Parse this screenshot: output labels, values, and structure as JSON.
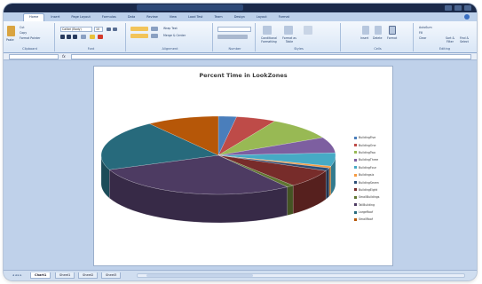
{
  "ribbon": {
    "tabs": [
      "Home",
      "Insert",
      "Page Layout",
      "Formulas",
      "Data",
      "Review",
      "View",
      "Load Test",
      "Team",
      "Design",
      "Layout",
      "Format"
    ],
    "groups": {
      "clipboard": "Clipboard",
      "font": "Font",
      "alignment": "Alignment",
      "number": "Number",
      "styles": "Styles",
      "cells": "Cells",
      "editing": "Editing"
    },
    "clipboard_buttons": {
      "paste": "Paste",
      "cut": "Cut",
      "copy": "Copy",
      "format_painter": "Format Painter"
    },
    "font_name": "Calibri (Body)",
    "font_size": "10",
    "alignment_buttons": {
      "wrap": "Wrap Text",
      "merge": "Merge & Center"
    },
    "styles_buttons": {
      "conditional": "Conditional Formatting",
      "table": "Format as Table"
    },
    "cells_buttons": {
      "insert": "Insert",
      "delete": "Delete",
      "format": "Format"
    },
    "editing_buttons": {
      "autosum": "AutoSum",
      "fill": "Fill",
      "clear": "Clear",
      "sort": "Sort & Filter",
      "find": "Find & Select"
    }
  },
  "formula_bar": {
    "fx": "fx"
  },
  "sheets": [
    "Chart1",
    "Sheet1",
    "Sheet2",
    "Sheet3"
  ],
  "active_sheet": "Chart1",
  "colors": {
    "accent": "#1b2a4a",
    "ribbon": "#d9e6f6",
    "workspace": "#bfd1ea"
  },
  "chart_data": {
    "type": "pie",
    "style": "3d",
    "title": "Percent Time in LookZones",
    "categories": [
      "BuildingFive",
      "BuildingOne",
      "BuildingTwo",
      "BuildingThree",
      "BuildingFour",
      "Buildingsix",
      "BuildingSeven",
      "BuildingEight",
      "SmallBuildings",
      "TallBuilding",
      "LargeRoof",
      "SmallRoof"
    ],
    "values": [
      2.5,
      5.5,
      9.5,
      6.5,
      5.5,
      0.8,
      1.2,
      7.5,
      1.0,
      29.0,
      21.0,
      10.0
    ],
    "colors": [
      "#4a7ebb",
      "#be4b48",
      "#98b954",
      "#7d5fa0",
      "#46aac5",
      "#f59b43",
      "#2c4d75",
      "#772c2a",
      "#5f7530",
      "#4d3b62",
      "#276a7c",
      "#b65708"
    ],
    "legend_position": "right"
  }
}
